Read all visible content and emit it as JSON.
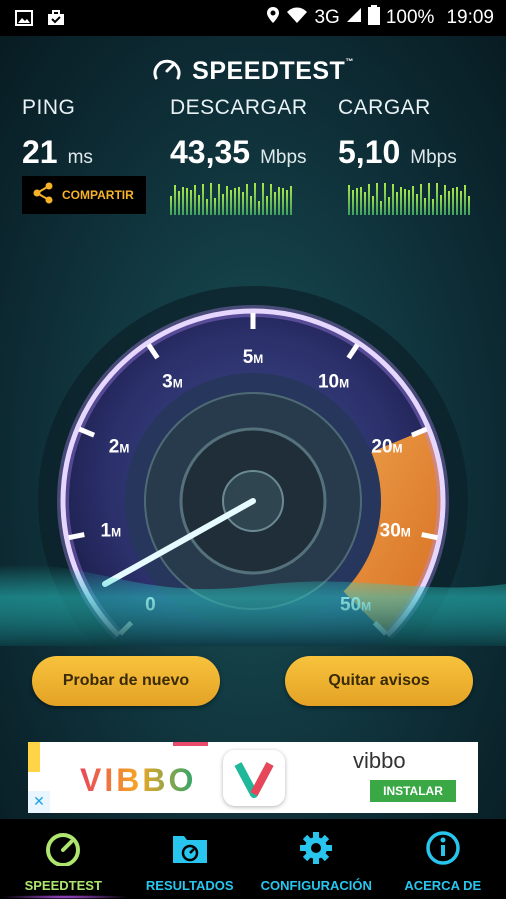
{
  "status_bar": {
    "network": "3G",
    "battery": "100%",
    "time": "19:09"
  },
  "brand": {
    "title": "SPEEDTEST",
    "trademark": "™"
  },
  "metrics": {
    "ping": {
      "label": "PING",
      "value": "21",
      "unit": "ms"
    },
    "download": {
      "label": "DESCARGAR",
      "value": "43,35",
      "unit": "Mbps"
    },
    "upload": {
      "label": "CARGAR",
      "value": "5,10",
      "unit": "Mbps"
    }
  },
  "share_button": {
    "label": "COMPARTIR"
  },
  "gauge": {
    "ticks": [
      {
        "num": "0",
        "unit": ""
      },
      {
        "num": "1",
        "unit": "M"
      },
      {
        "num": "2",
        "unit": "M"
      },
      {
        "num": "3",
        "unit": "M"
      },
      {
        "num": "5",
        "unit": "M"
      },
      {
        "num": "10",
        "unit": "M"
      },
      {
        "num": "20",
        "unit": "M"
      },
      {
        "num": "30",
        "unit": "M"
      },
      {
        "num": "50",
        "unit": "M"
      }
    ],
    "needle_value": "0.5"
  },
  "buttons": {
    "retry": "Probar de nuevo",
    "remove_ads": "Quitar avisos"
  },
  "ad": {
    "logo_text": "VIBBO",
    "brand": "vibbo",
    "install": "INSTALAR",
    "close": "✕"
  },
  "nav": {
    "items": [
      {
        "label": "SPEEDTEST",
        "icon": "speedometer-icon",
        "active": true
      },
      {
        "label": "RESULTADOS",
        "icon": "results-folder-icon"
      },
      {
        "label": "CONFIGURACIÓN",
        "icon": "gear-icon"
      },
      {
        "label": "ACERCA DE",
        "icon": "info-icon"
      }
    ]
  },
  "colors": {
    "accent_green": "#aee66f",
    "accent_blue": "#28c6ef",
    "button_yellow": "#f1b532",
    "gauge_orange": "#f2892c",
    "gauge_purple": "#a56ce8"
  }
}
